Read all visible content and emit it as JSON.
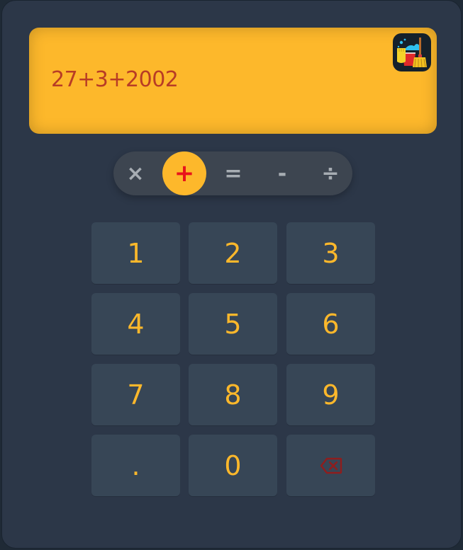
{
  "display": {
    "expression": "27+3+2002"
  },
  "operators": {
    "multiply": "×",
    "add": "+",
    "equals": "=",
    "subtract": "-",
    "divide": "÷",
    "active": "add"
  },
  "keypad": {
    "k1": "1",
    "k2": "2",
    "k3": "3",
    "k4": "4",
    "k5": "5",
    "k6": "6",
    "k7": "7",
    "k8": "8",
    "k9": "9",
    "dot": ".",
    "k0": "0",
    "backspace_icon": "backspace-icon"
  },
  "clear_icon": "cleaning-icon",
  "colors": {
    "accent": "#fdb82b",
    "expression_text": "#b83c25",
    "active_operator_text": "#e8141b",
    "key_bg": "#374656",
    "app_bg": "#2c3748",
    "backspace": "#8f1d1d"
  }
}
